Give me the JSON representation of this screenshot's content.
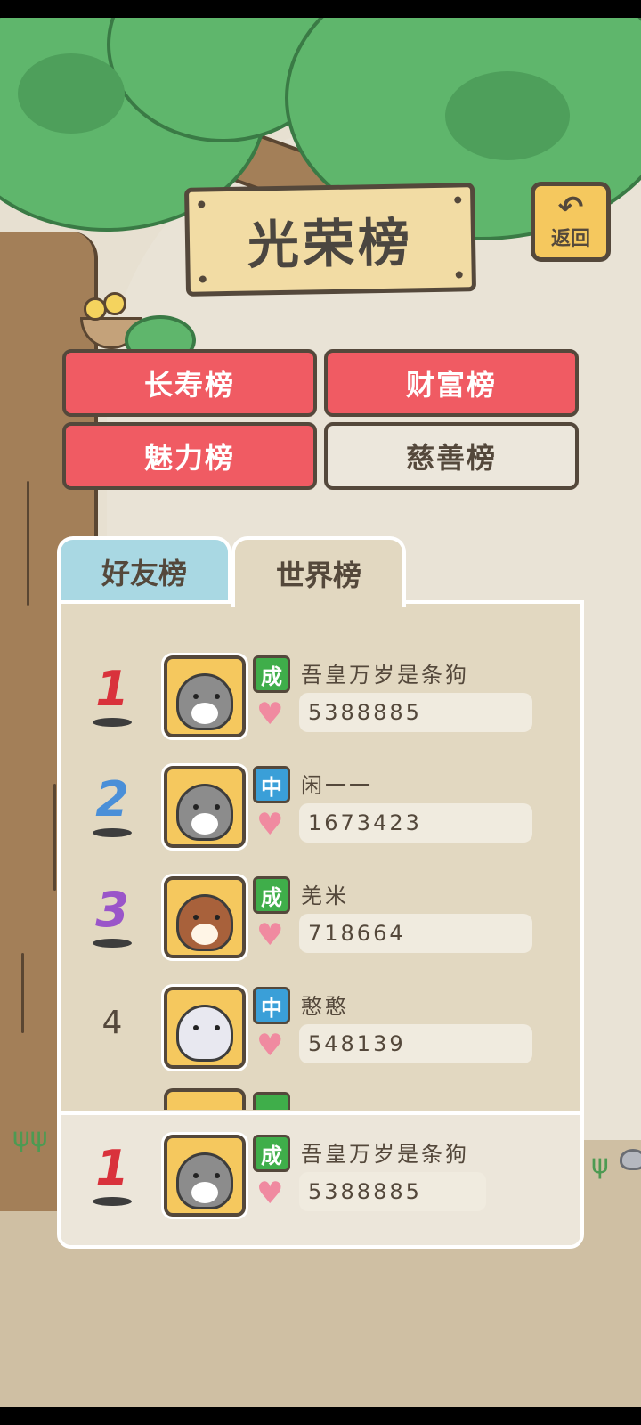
{
  "header": {
    "title": "光荣榜",
    "back_label": "返回"
  },
  "categories": [
    {
      "label": "长寿榜",
      "style": "red"
    },
    {
      "label": "财富榜",
      "style": "red"
    },
    {
      "label": "魅力榜",
      "style": "red"
    },
    {
      "label": "慈善榜",
      "style": "light"
    }
  ],
  "tabs": [
    {
      "label": "好友榜",
      "selected": false
    },
    {
      "label": "世界榜",
      "selected": true
    }
  ],
  "ranking": [
    {
      "rank": "1",
      "stage": "成",
      "name": "吾皇万岁是条狗",
      "score": "5388885",
      "avatar": "cat",
      "rank_color": "#d9323c"
    },
    {
      "rank": "2",
      "stage": "中",
      "name": "闲一一",
      "score": "1673423",
      "avatar": "cat",
      "rank_color": "#4a8fd8"
    },
    {
      "rank": "3",
      "stage": "成",
      "name": "羌米",
      "score": "718664",
      "avatar": "bird",
      "rank_color": "#9a55c9"
    },
    {
      "rank": "4",
      "stage": "中",
      "name": "憨憨",
      "score": "548139",
      "avatar": "hedgehog",
      "rank_color": "#54483b"
    }
  ],
  "my_rank": {
    "rank": "1",
    "stage": "成",
    "name": "吾皇万岁是条狗",
    "score": "5388885",
    "avatar": "cat"
  },
  "icons": {
    "back": "return-arrow-icon",
    "heart": "heart-icon"
  },
  "colors": {
    "red_button": "#f05b63",
    "tab_blue": "#a9d8e3",
    "stage_green": "#3fae4a",
    "stage_blue": "#3a9fd8"
  }
}
